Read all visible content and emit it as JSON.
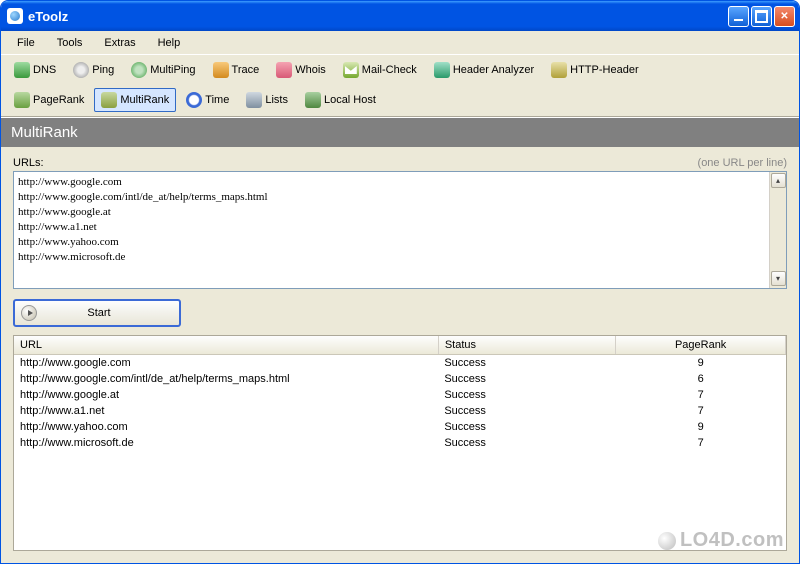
{
  "title": "eToolz",
  "menu": {
    "items": [
      "File",
      "Tools",
      "Extras",
      "Help"
    ]
  },
  "toolbar": {
    "row1": [
      {
        "id": "dns",
        "label": "DNS"
      },
      {
        "id": "ping",
        "label": "Ping"
      },
      {
        "id": "multiping",
        "label": "MultiPing"
      },
      {
        "id": "trace",
        "label": "Trace"
      },
      {
        "id": "whois",
        "label": "Whois"
      },
      {
        "id": "mail",
        "label": "Mail-Check"
      },
      {
        "id": "header",
        "label": "Header Analyzer"
      },
      {
        "id": "http",
        "label": "HTTP-Header"
      }
    ],
    "row2": [
      {
        "id": "pagerank",
        "label": "PageRank"
      },
      {
        "id": "multirank",
        "label": "MultiRank",
        "active": true
      },
      {
        "id": "time",
        "label": "Time"
      },
      {
        "id": "lists",
        "label": "Lists"
      },
      {
        "id": "localhost",
        "label": "Local Host"
      }
    ]
  },
  "section": {
    "title": "MultiRank"
  },
  "urls": {
    "label": "URLs:",
    "hint": "(one URL per line)",
    "value": "http://www.google.com\nhttp://www.google.com/intl/de_at/help/terms_maps.html\nhttp://www.google.at\nhttp://www.a1.net\nhttp://www.yahoo.com\nhttp://www.microsoft.de"
  },
  "start": {
    "label": "Start"
  },
  "results": {
    "columns": {
      "url": "URL",
      "status": "Status",
      "pagerank": "PageRank"
    },
    "rows": [
      {
        "url": "http://www.google.com",
        "status": "Success",
        "pagerank": "9"
      },
      {
        "url": "http://www.google.com/intl/de_at/help/terms_maps.html",
        "status": "Success",
        "pagerank": "6"
      },
      {
        "url": "http://www.google.at",
        "status": "Success",
        "pagerank": "7"
      },
      {
        "url": "http://www.a1.net",
        "status": "Success",
        "pagerank": "7"
      },
      {
        "url": "http://www.yahoo.com",
        "status": "Success",
        "pagerank": "9"
      },
      {
        "url": "http://www.microsoft.de",
        "status": "Success",
        "pagerank": "7"
      }
    ]
  },
  "watermark": "LO4D.com"
}
